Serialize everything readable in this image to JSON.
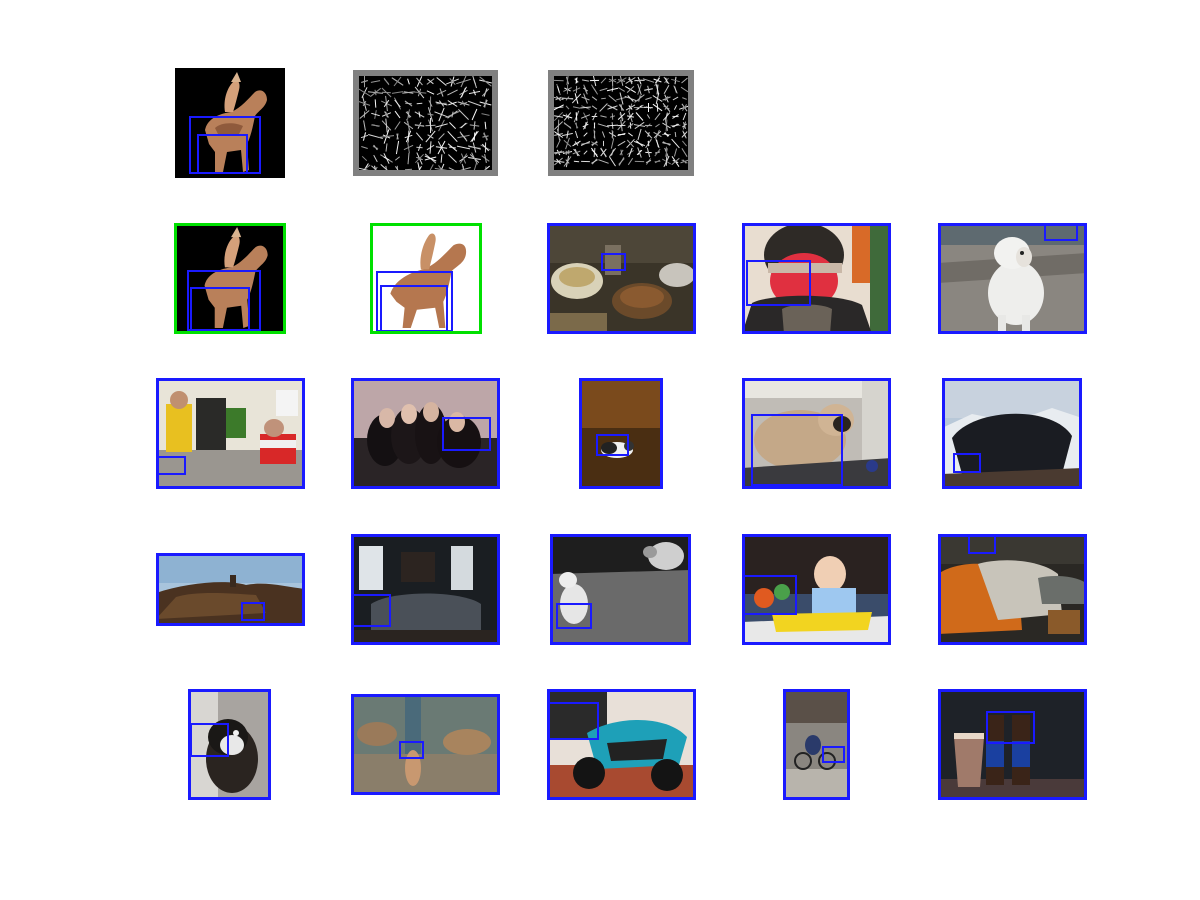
{
  "colors": {
    "detection_box": "#1a1aff",
    "positive_frame": "#00e000",
    "negative_frame": "#1a1aff",
    "hog_border": "#808080",
    "hog_background": "#000000"
  },
  "tiles": [
    {
      "name": "query-horse-rider-image",
      "subject": "horse-rider"
    },
    {
      "name": "hog-root-filter",
      "subject": "hog"
    },
    {
      "name": "hog-part-filter",
      "subject": "hog"
    },
    {
      "name": "positive-horse-rider-image",
      "subject": "horse-rider",
      "frame": "positive"
    },
    {
      "name": "positive-horse-rider-cutout",
      "subject": "horse-cutout",
      "frame": "positive"
    },
    {
      "name": "detection-kitchen-table",
      "subject": "kitchen",
      "frame": "negative"
    },
    {
      "name": "detection-masked-person",
      "subject": "mask-person",
      "frame": "negative"
    },
    {
      "name": "detection-white-dog",
      "subject": "white-dog",
      "frame": "negative"
    },
    {
      "name": "detection-cyclists",
      "subject": "cyclists",
      "frame": "negative"
    },
    {
      "name": "detection-group-on-couch",
      "subject": "couch-group",
      "frame": "negative"
    },
    {
      "name": "detection-cat-on-floor",
      "subject": "cat-floor",
      "frame": "negative"
    },
    {
      "name": "detection-pug",
      "subject": "pug",
      "frame": "negative"
    },
    {
      "name": "detection-group-mountain",
      "subject": "mountain-group",
      "frame": "negative"
    },
    {
      "name": "detection-rocky-landscape",
      "subject": "rocky-landscape",
      "frame": "negative"
    },
    {
      "name": "detection-living-room",
      "subject": "living-room",
      "frame": "negative"
    },
    {
      "name": "detection-dog-and-sheep",
      "subject": "dog-sheep",
      "frame": "negative"
    },
    {
      "name": "detection-baby-walker",
      "subject": "baby",
      "frame": "negative"
    },
    {
      "name": "detection-vintage-car",
      "subject": "vintage-car",
      "frame": "negative"
    },
    {
      "name": "detection-bird-closeup",
      "subject": "bird-closeup",
      "frame": "negative"
    },
    {
      "name": "detection-birds-feeder",
      "subject": "birds-feeder",
      "frame": "negative"
    },
    {
      "name": "detection-motorcycle",
      "subject": "motorcycle",
      "frame": "negative"
    },
    {
      "name": "detection-cyclist-street",
      "subject": "cyclist-street",
      "frame": "negative"
    },
    {
      "name": "detection-beer-bottles",
      "subject": "beer",
      "frame": "negative"
    }
  ]
}
